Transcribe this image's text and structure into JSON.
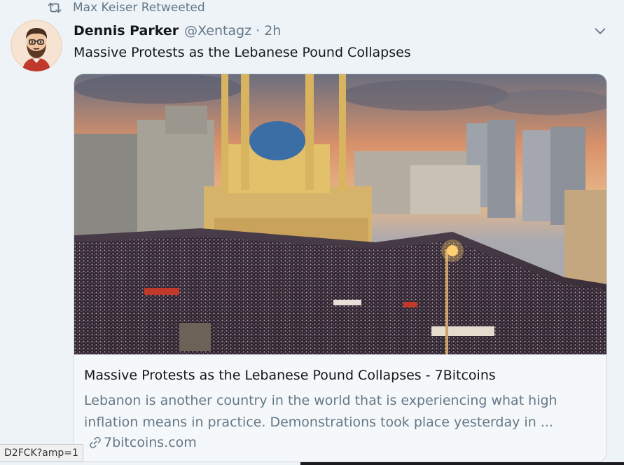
{
  "retweet": {
    "text": "Max Keiser Retweeted"
  },
  "tweet": {
    "author_name": "Dennis Parker",
    "author_handle": "@Xentagz",
    "separator": "·",
    "timestamp": "2h",
    "text": "Massive Protests as the Lebanese Pound Collapses"
  },
  "card": {
    "title": "Massive Protests as the Lebanese Pound Collapses - 7Bitcoins",
    "description": "Lebanon is another country in the world that is experiencing what high inflation means in practice. Demonstrations took place yesterday in ...",
    "domain": "7bitcoins.com"
  },
  "status_bar": {
    "url": "D2FCK?amp=1"
  },
  "icons": {
    "retweet": "retweet-icon",
    "caret": "chevron-down-icon",
    "link": "link-icon"
  },
  "colors": {
    "primary_text": "#14171a",
    "secondary_text": "#657786",
    "background": "#eef3f8"
  }
}
